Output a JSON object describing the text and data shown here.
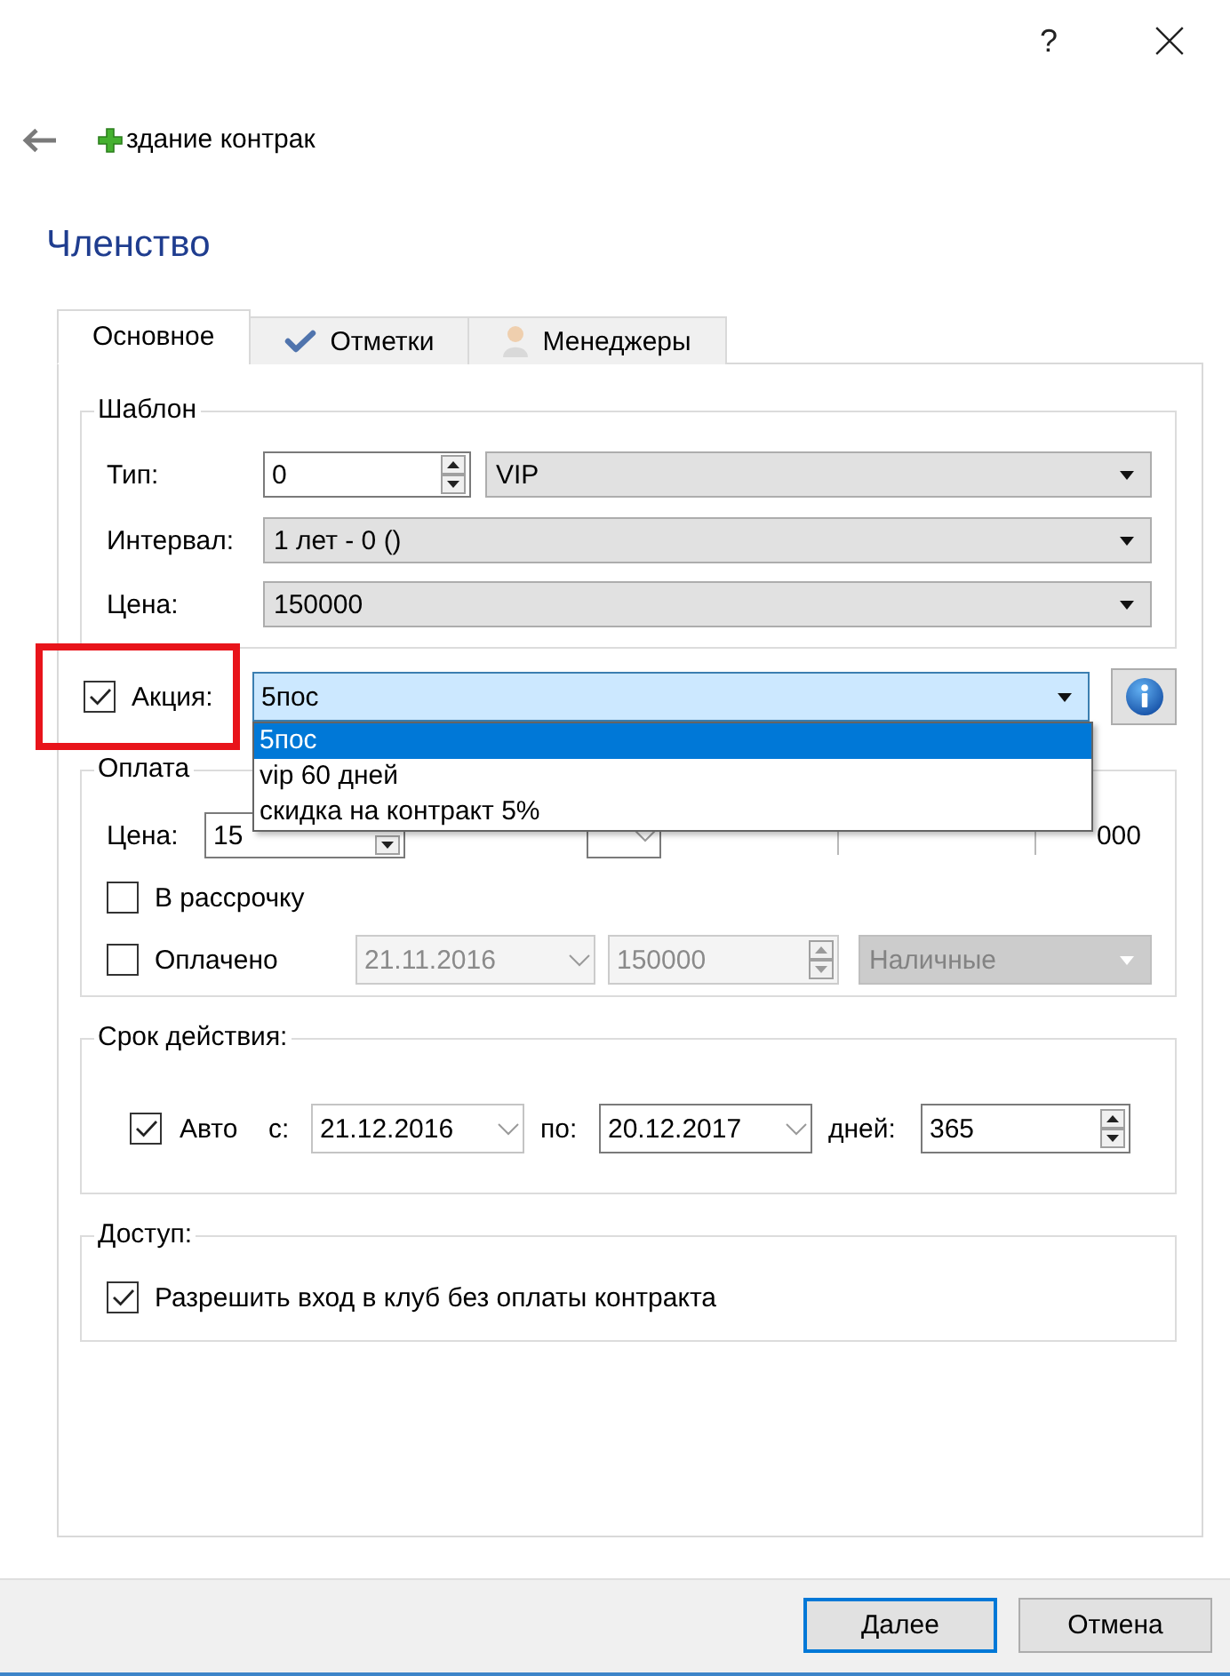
{
  "window": {
    "help": "?"
  },
  "header": {
    "title": "здание контрак"
  },
  "section": {
    "title": "Членство"
  },
  "tabs": [
    {
      "label": "Основное",
      "selected": true,
      "kind": "plain"
    },
    {
      "label": "Отметки",
      "selected": false,
      "kind": "check"
    },
    {
      "label": "Менеджеры",
      "selected": false,
      "kind": "person"
    }
  ],
  "template": {
    "legend": "Шаблон",
    "rows": [
      {
        "label": "Тип:",
        "kind": "spin-combo",
        "value": "0",
        "choice": "VIP"
      },
      {
        "label": "Интервал:",
        "kind": "combo",
        "choice": "1 лет - 0 ()"
      },
      {
        "label": "Цена:",
        "kind": "combo",
        "choice": "150000"
      }
    ]
  },
  "promo": {
    "label": "Акция:",
    "checked": true,
    "highlighted": true,
    "value": "5пос",
    "expanded": true,
    "options": [
      {
        "label": "5пос",
        "selected": true
      },
      {
        "label": "vip 60 дней",
        "selected": false
      },
      {
        "label": "скидка на контракт 5%",
        "selected": false
      }
    ]
  },
  "payment": {
    "legend": "Оплата",
    "price_label": "Цена:",
    "price": "15",
    "due": "000",
    "installments": {
      "label": "В рассрочку",
      "checked": false
    },
    "paid": {
      "label": "Оплачено",
      "checked": false,
      "date": "21.11.2016",
      "amount": "150000",
      "method": "Наличные"
    }
  },
  "validity": {
    "legend": "Срок действия:",
    "auto": {
      "label": "Авто",
      "checked": true
    },
    "from_label": "с:",
    "from": "21.12.2016",
    "to_label": "по:",
    "to": "20.12.2017",
    "days_label": "дней:",
    "days": "365"
  },
  "access": {
    "legend": "Доступ:",
    "allow": {
      "label": "Разрешить вход в клуб без оплаты контракта",
      "checked": true
    }
  },
  "buttons": [
    {
      "label": "Далее",
      "kind": "default"
    },
    {
      "label": "Отмена",
      "kind": "normal"
    }
  ]
}
